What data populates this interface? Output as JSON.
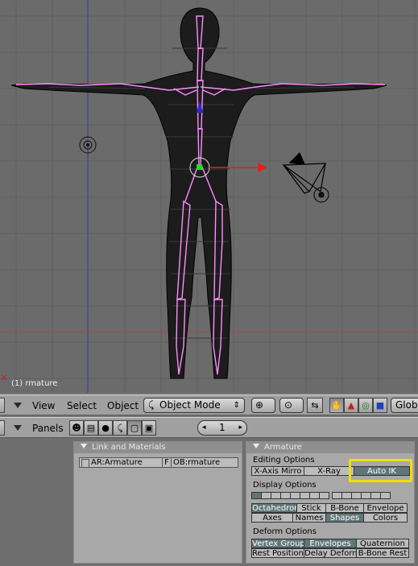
{
  "viewport": {
    "object_label": "(1) rmature"
  },
  "header": {
    "menu_view": "View",
    "menu_select": "Select",
    "menu_object": "Object",
    "mode_select": "Object Mode",
    "mode_arrows": "⇕",
    "orientation_label": "Glob"
  },
  "buttons_header": {
    "panels_label": "Panels",
    "frame_value": "1",
    "frame_left": "◂",
    "frame_right": "▸"
  },
  "link_panel": {
    "title": "Link and Materials",
    "armature_field": "AR:Armature",
    "fake_user": "F",
    "object_field": "OB:rmature"
  },
  "armature_panel": {
    "title": "Armature",
    "editing_label": "Editing Options",
    "x_axis_mirror": "X-Axis Mirro",
    "x_ray": "X-Ray",
    "auto_ik": "Auto IK",
    "display_label": "Display Options",
    "octahedron": "Octahedron",
    "stick": "Stick",
    "b_bone": "B-Bone",
    "envelope": "Envelope",
    "axes": "Axes",
    "names": "Names",
    "shapes": "Shapes",
    "colors": "Colors",
    "deform_label": "Deform Options",
    "vertex_group": "Vertex Group",
    "envelopes": "Envelopes",
    "quaternion": "Quaternion",
    "rest_position": "Rest Position",
    "delay_deform": "Delay Deform",
    "b_bone_rest": "B-Bone Rest"
  },
  "colors": {
    "highlight": "#f0e000",
    "active_button": "#5f7677",
    "bone_color": "#ff8cff"
  }
}
